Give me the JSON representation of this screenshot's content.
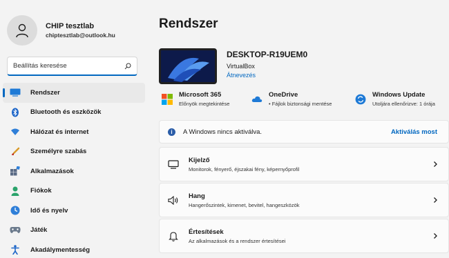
{
  "profile": {
    "name": "CHIP tesztlab",
    "email": "chiptesztlab@outlook.hu"
  },
  "search": {
    "placeholder": "Beállítás keresése"
  },
  "sidebar": {
    "items": [
      {
        "label": "Rendszer",
        "icon": "monitor-icon"
      },
      {
        "label": "Bluetooth és eszközök",
        "icon": "bluetooth-icon"
      },
      {
        "label": "Hálózat és internet",
        "icon": "wifi-icon"
      },
      {
        "label": "Személyre szabás",
        "icon": "brush-icon"
      },
      {
        "label": "Alkalmazások",
        "icon": "apps-icon"
      },
      {
        "label": "Fiókok",
        "icon": "person-icon"
      },
      {
        "label": "Idő és nyelv",
        "icon": "clock-globe-icon"
      },
      {
        "label": "Játék",
        "icon": "gamepad-icon"
      },
      {
        "label": "Akadálymentesség",
        "icon": "accessibility-icon"
      }
    ]
  },
  "main": {
    "title": "Rendszer",
    "device": {
      "name": "DESKTOP-R19UEM0",
      "model": "VirtualBox",
      "rename": "Átnevezés"
    },
    "quick": [
      {
        "title": "Microsoft 365",
        "subtitle": "Előnyök megtekintése"
      },
      {
        "title": "OneDrive",
        "subtitle": "• Fájlok biztonsági mentése"
      },
      {
        "title": "Windows Update",
        "subtitle": "Utoljára ellenőrizve: 1 órája"
      }
    ],
    "activation": {
      "text": "A Windows nincs aktiválva.",
      "action": "Aktiválás most"
    },
    "settings": [
      {
        "title": "Kijelző",
        "subtitle": "Monitorok, fényerő, éjszakai fény, képernyőprofil"
      },
      {
        "title": "Hang",
        "subtitle": "Hangerőszintek, kimenet, bevitel, hangeszközök"
      },
      {
        "title": "Értesítések",
        "subtitle": "Az alkalmazások és a rendszer értesítései"
      }
    ]
  },
  "colors": {
    "accent": "#0067c0",
    "background": "#f3f3f3",
    "card": "#fbfbfb"
  }
}
